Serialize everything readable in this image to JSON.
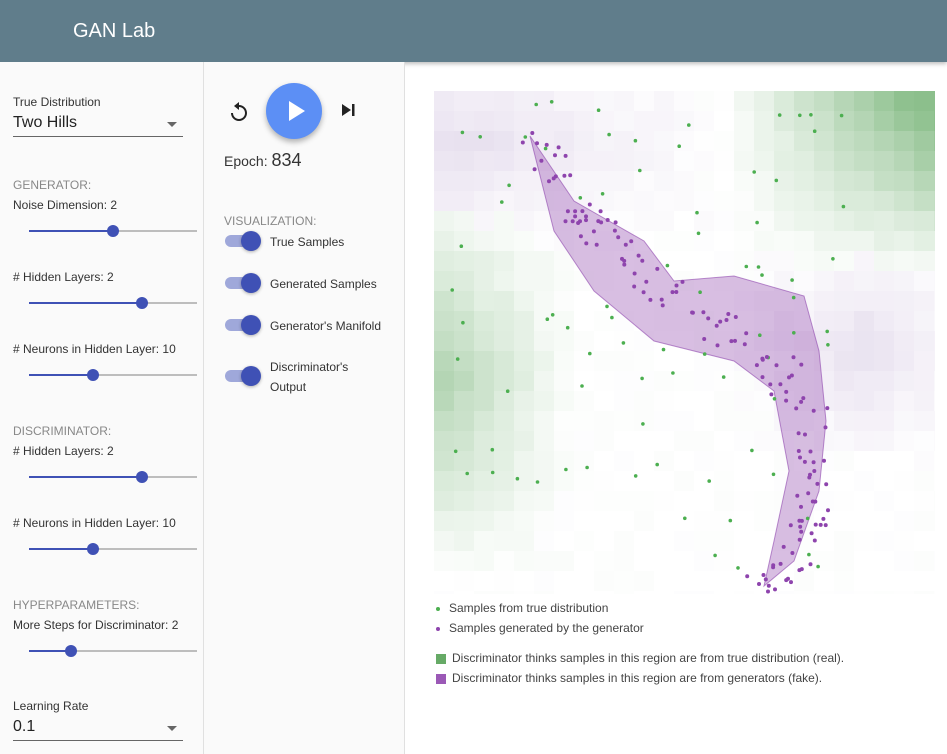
{
  "app": {
    "title": "GAN Lab"
  },
  "left": {
    "true_distribution": {
      "label": "True Distribution",
      "value": "Two Hills"
    },
    "generator": {
      "section": "GENERATOR:",
      "noise_dimension": {
        "label": "Noise Dimension: 2",
        "level": 0.5
      },
      "hidden_layers": {
        "label": "# Hidden Layers: 2",
        "level": 0.67
      },
      "neurons": {
        "label": "# Neurons in Hidden Layer: 10",
        "level": 0.38
      }
    },
    "discriminator": {
      "section": "DISCRIMINATOR:",
      "hidden_layers": {
        "label": "# Hidden Layers: 2",
        "level": 0.67
      },
      "neurons": {
        "label": "# Neurons in Hidden Layer: 10",
        "level": 0.38
      }
    },
    "hyperparameters": {
      "section": "HYPERPARAMETERS:",
      "steps": {
        "label": "More Steps for Discriminator: 2",
        "level": 0.25
      },
      "learning_rate": {
        "label": "Learning Rate",
        "value": "0.1"
      }
    }
  },
  "controls": {
    "epoch_label": "Epoch:",
    "epoch_value": "834",
    "icons": [
      "reset-icon",
      "play-icon",
      "step-icon"
    ]
  },
  "visualization": {
    "section": "VISUALIZATION:",
    "toggles": [
      {
        "label": "True Samples",
        "on": true
      },
      {
        "label": "Generated Samples",
        "on": true
      },
      {
        "label": "Generator's Manifold",
        "on": true
      },
      {
        "label": "Discriminator's",
        "label2": "Output",
        "on": true
      }
    ]
  },
  "legend": {
    "true_samples": "Samples from true distribution",
    "generated_samples": "Samples generated by the generator",
    "real_region": "Discriminator thinks samples in this region are from true distribution (real).",
    "fake_region": "Discriminator thinks samples in this region are from generators (fake)."
  },
  "colors": {
    "header": "#607d8b",
    "accent": "#3f51b5",
    "play": "#5c8ff5",
    "real": "#4caf50",
    "fake": "#8e44ad"
  }
}
